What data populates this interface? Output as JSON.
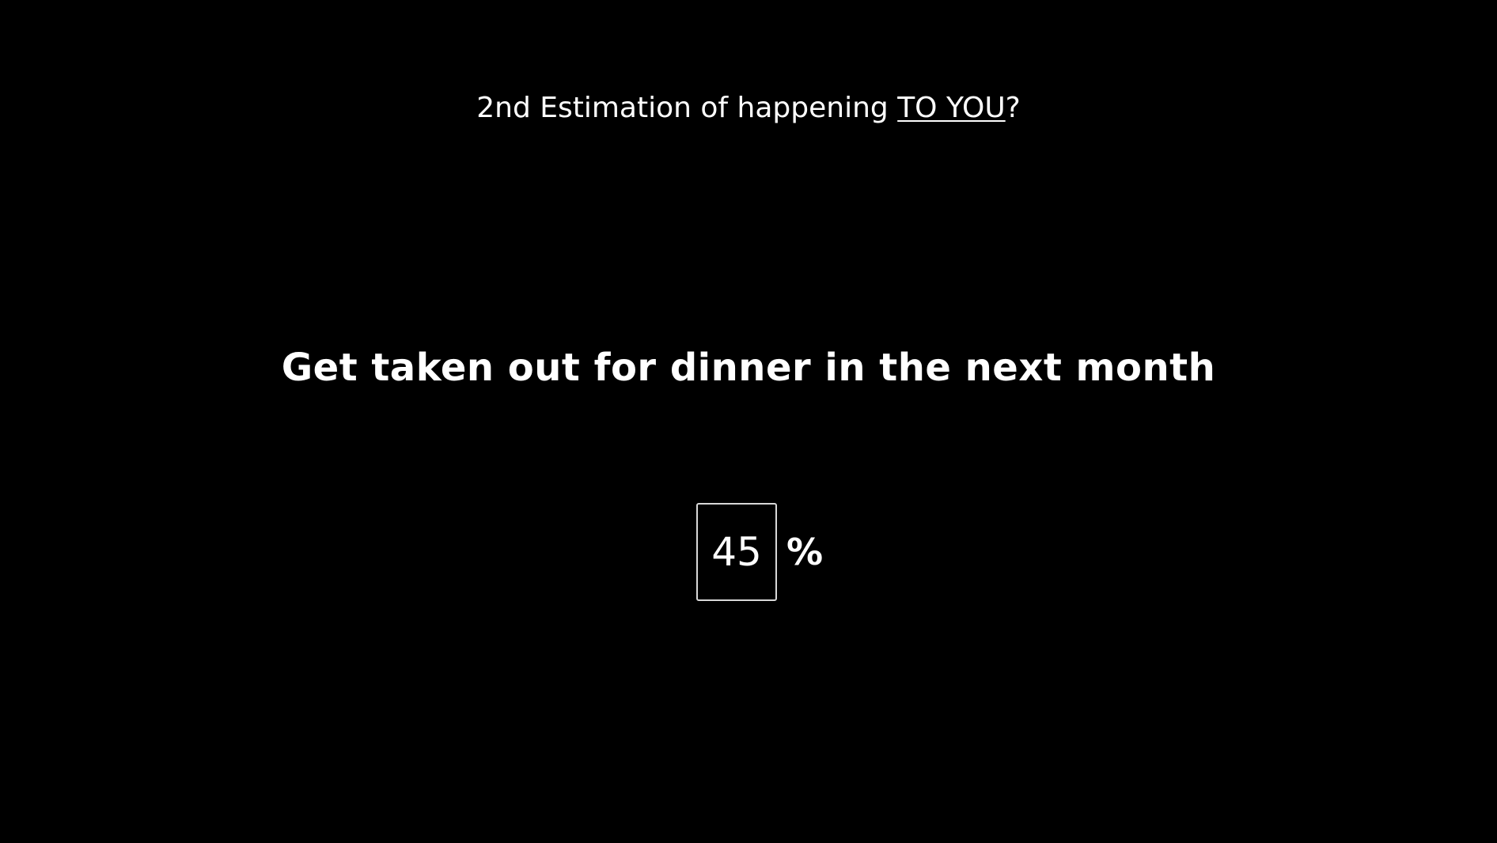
{
  "prompt": {
    "prefix": "2nd Estimation of happening ",
    "emphasis": "TO YOU",
    "suffix": "?"
  },
  "event": {
    "text": "Get taken out for dinner in the next month"
  },
  "answer": {
    "value": "45",
    "unit": "%"
  }
}
